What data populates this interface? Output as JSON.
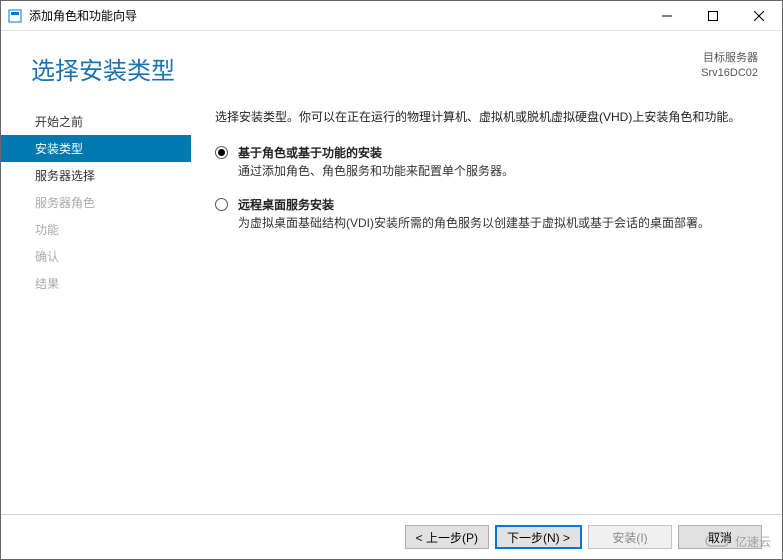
{
  "window": {
    "title": "添加角色和功能向导"
  },
  "header": {
    "page_title": "选择安装类型",
    "target_label": "目标服务器",
    "target_value": "Srv16DC02"
  },
  "sidebar": {
    "items": [
      {
        "label": "开始之前",
        "state": "normal"
      },
      {
        "label": "安装类型",
        "state": "active"
      },
      {
        "label": "服务器选择",
        "state": "normal"
      },
      {
        "label": "服务器角色",
        "state": "disabled"
      },
      {
        "label": "功能",
        "state": "disabled"
      },
      {
        "label": "确认",
        "state": "disabled"
      },
      {
        "label": "结果",
        "state": "disabled"
      }
    ]
  },
  "content": {
    "instruction": "选择安装类型。你可以在正在运行的物理计算机、虚拟机或脱机虚拟硬盘(VHD)上安装角色和功能。",
    "options": [
      {
        "title": "基于角色或基于功能的安装",
        "desc": "通过添加角色、角色服务和功能来配置单个服务器。",
        "checked": true
      },
      {
        "title": "远程桌面服务安装",
        "desc": "为虚拟桌面基础结构(VDI)安装所需的角色服务以创建基于虚拟机或基于会话的桌面部署。",
        "checked": false
      }
    ]
  },
  "footer": {
    "prev": "< 上一步(P)",
    "next": "下一步(N) >",
    "install": "安装(I)",
    "cancel": "取消"
  },
  "watermark": "亿速云"
}
